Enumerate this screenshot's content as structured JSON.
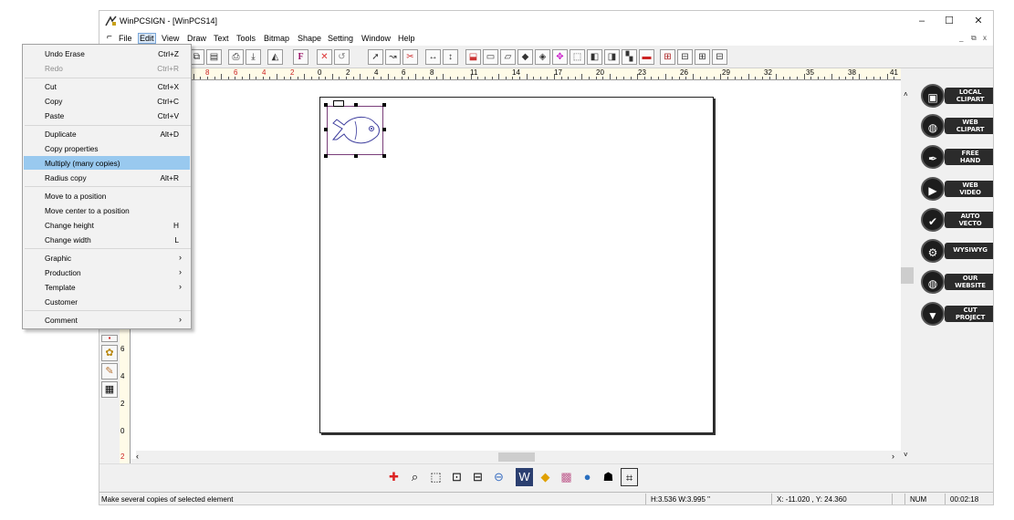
{
  "window": {
    "title": "WinPCSIGN - [WinPCS14]",
    "controls": [
      "–",
      "☐",
      "✕"
    ],
    "mdi_controls": [
      "_",
      "⧉",
      "x"
    ]
  },
  "menubar": [
    "File",
    "Edit",
    "View",
    "Draw",
    "Text",
    "Tools",
    "Bitmap",
    "Shape",
    "Setting",
    "Window",
    "Help"
  ],
  "edit_menu": {
    "items": [
      {
        "label": "Undo  Erase",
        "shortcut": "Ctrl+Z",
        "disabled": false
      },
      {
        "label": "Redo",
        "shortcut": "Ctrl+R",
        "disabled": true
      },
      {
        "label": "Cut",
        "shortcut": "Ctrl+X"
      },
      {
        "label": "Copy",
        "shortcut": "Ctrl+C"
      },
      {
        "label": "Paste",
        "shortcut": "Ctrl+V"
      },
      {
        "label": "Duplicate",
        "shortcut": "Alt+D"
      },
      {
        "label": "Copy properties",
        "shortcut": ""
      },
      {
        "label": "Multiply (many copies)",
        "shortcut": "",
        "highlighted": true
      },
      {
        "label": "Radius copy",
        "shortcut": "Alt+R"
      },
      {
        "label": "Move to a position",
        "shortcut": ""
      },
      {
        "label": "Move center to a position",
        "shortcut": ""
      },
      {
        "label": "Change height",
        "shortcut": "H"
      },
      {
        "label": "Change width",
        "shortcut": "L"
      },
      {
        "label": "Graphic",
        "submenu": true
      },
      {
        "label": "Production",
        "submenu": true
      },
      {
        "label": "Template",
        "submenu": true
      },
      {
        "label": "Customer"
      },
      {
        "label": "Comment",
        "submenu": true
      }
    ]
  },
  "ruler": {
    "h_labels": [
      "8",
      "6",
      "4",
      "2",
      "0",
      "2",
      "4",
      "6",
      "8",
      "11",
      "14",
      "17",
      "20",
      "23",
      "26",
      "29",
      "32",
      "35",
      "38",
      "41"
    ],
    "v_labels": [
      "6",
      "4",
      "2",
      "0",
      "2"
    ]
  },
  "right_panel": [
    {
      "line1": "LOCAL",
      "line2": "CLIPART",
      "icon": "folder-icon"
    },
    {
      "line1": "WEB",
      "line2": "CLIPART",
      "icon": "globe-icon"
    },
    {
      "line1": "FREE",
      "line2": "HAND",
      "icon": "pen-icon"
    },
    {
      "line1": "WEB",
      "line2": "VIDEO",
      "icon": "video-icon"
    },
    {
      "line1": "AUTO",
      "line2": "VECTO",
      "icon": "check-icon"
    },
    {
      "line1": "WYSIWYG",
      "line2": "",
      "icon": "gear-icon"
    },
    {
      "line1": "OUR",
      "line2": "WEBSITE",
      "icon": "globe-icon"
    },
    {
      "line1": "CUT",
      "line2": "PROJECT",
      "icon": "cutter-icon"
    }
  ],
  "status": {
    "message": "Make several copies of selected element",
    "size": "H:3.536   W:3.995  \"",
    "coords": "X: -11.020 , Y: 24.360",
    "num": "NUM",
    "time": "00:02:18"
  },
  "colors": {
    "highlight": "#99c9ef",
    "selection": "#7a3f7a",
    "fish_stroke": "#3b3b9c"
  }
}
